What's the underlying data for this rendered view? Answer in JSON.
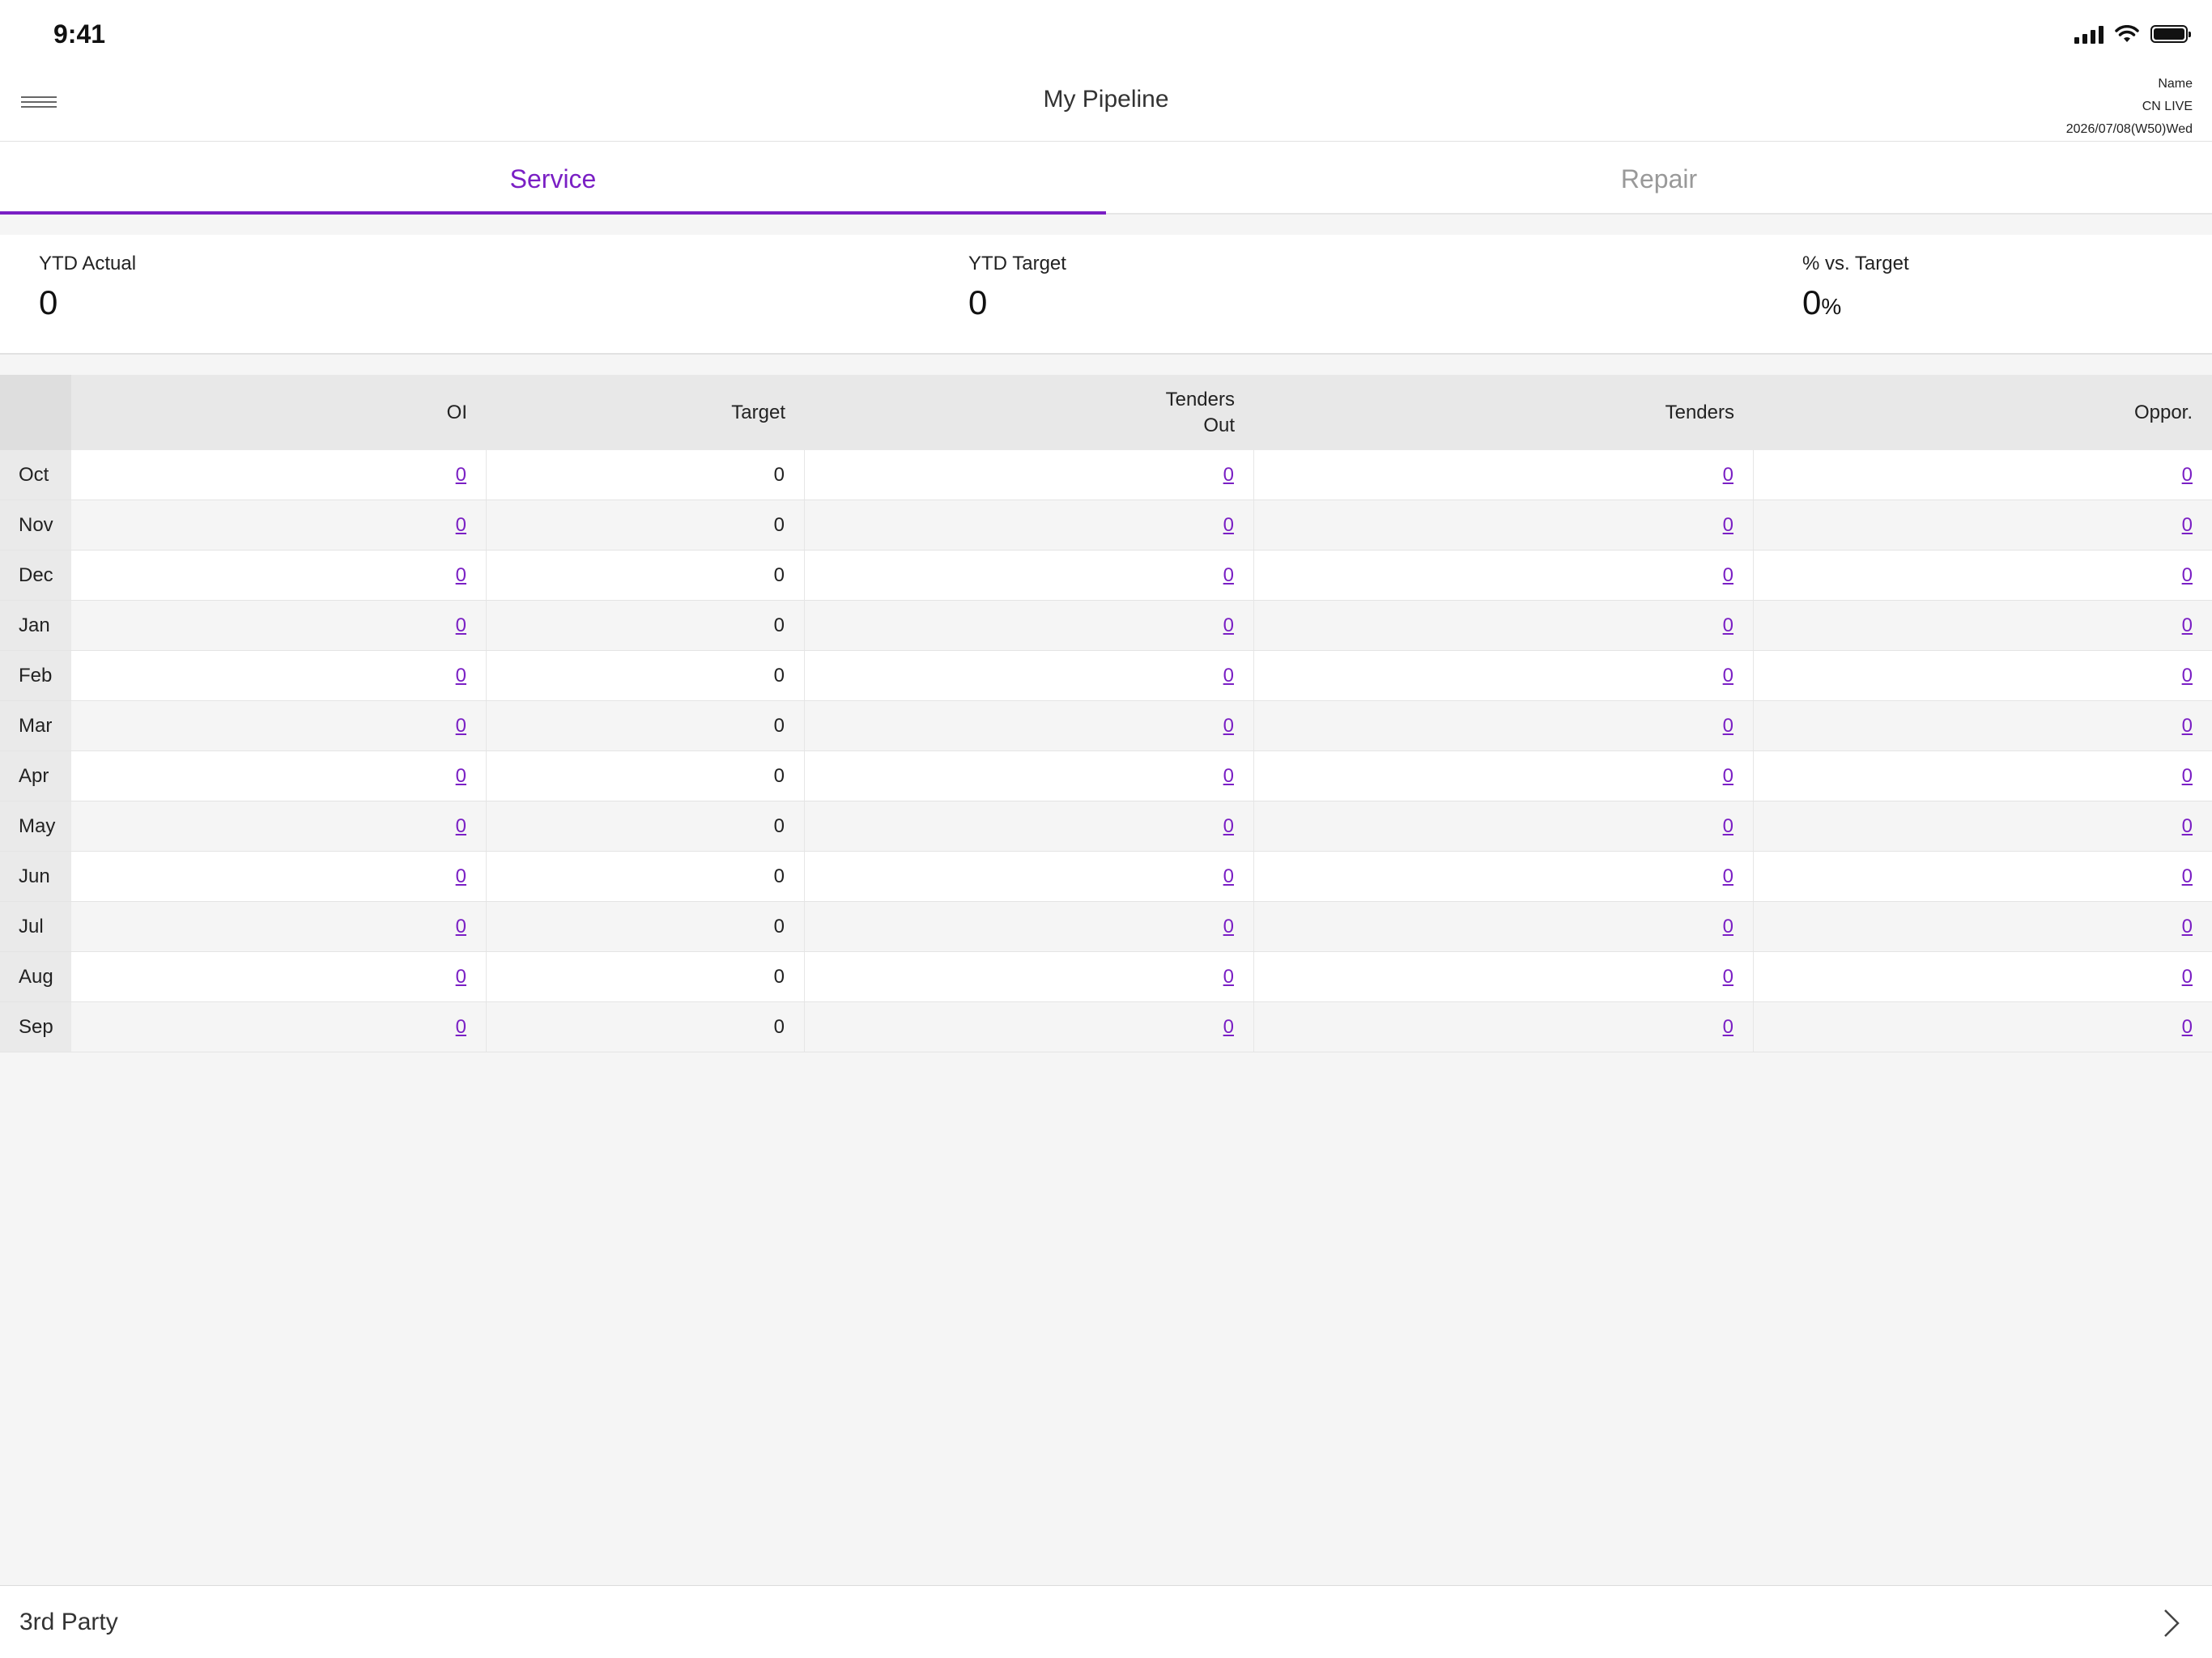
{
  "status_bar": {
    "time": "9:41"
  },
  "header": {
    "title": "My Pipeline",
    "user_name": "Name",
    "environment": "CN LIVE",
    "date": "2026/07/08(W50)Wed"
  },
  "tabs": [
    {
      "label": "Service",
      "active": true
    },
    {
      "label": "Repair",
      "active": false
    }
  ],
  "kpis": {
    "ytd_actual": {
      "label": "YTD Actual",
      "value": "0"
    },
    "ytd_target": {
      "label": "YTD Target",
      "value": "0"
    },
    "pct_vs_target": {
      "label": "% vs. Target",
      "value": "0",
      "unit": "%"
    }
  },
  "table": {
    "columns": [
      "OI",
      "Target",
      "Tenders\nOut",
      "Tenders",
      "Oppor."
    ],
    "rows": [
      {
        "month": "Oct",
        "oi": "0",
        "target": "0",
        "tenders_out": "0",
        "tenders": "0",
        "oppor": "0"
      },
      {
        "month": "Nov",
        "oi": "0",
        "target": "0",
        "tenders_out": "0",
        "tenders": "0",
        "oppor": "0"
      },
      {
        "month": "Dec",
        "oi": "0",
        "target": "0",
        "tenders_out": "0",
        "tenders": "0",
        "oppor": "0"
      },
      {
        "month": "Jan",
        "oi": "0",
        "target": "0",
        "tenders_out": "0",
        "tenders": "0",
        "oppor": "0"
      },
      {
        "month": "Feb",
        "oi": "0",
        "target": "0",
        "tenders_out": "0",
        "tenders": "0",
        "oppor": "0"
      },
      {
        "month": "Mar",
        "oi": "0",
        "target": "0",
        "tenders_out": "0",
        "tenders": "0",
        "oppor": "0"
      },
      {
        "month": "Apr",
        "oi": "0",
        "target": "0",
        "tenders_out": "0",
        "tenders": "0",
        "oppor": "0"
      },
      {
        "month": "May",
        "oi": "0",
        "target": "0",
        "tenders_out": "0",
        "tenders": "0",
        "oppor": "0"
      },
      {
        "month": "Jun",
        "oi": "0",
        "target": "0",
        "tenders_out": "0",
        "tenders": "0",
        "oppor": "0"
      },
      {
        "month": "Jul",
        "oi": "0",
        "target": "0",
        "tenders_out": "0",
        "tenders": "0",
        "oppor": "0"
      },
      {
        "month": "Aug",
        "oi": "0",
        "target": "0",
        "tenders_out": "0",
        "tenders": "0",
        "oppor": "0"
      },
      {
        "month": "Sep",
        "oi": "0",
        "target": "0",
        "tenders_out": "0",
        "tenders": "0",
        "oppor": "0"
      }
    ]
  },
  "bottom_bar": {
    "label": "3rd Party"
  },
  "colors": {
    "accent": "#7a1fc4",
    "background": "#f5f5f5"
  }
}
